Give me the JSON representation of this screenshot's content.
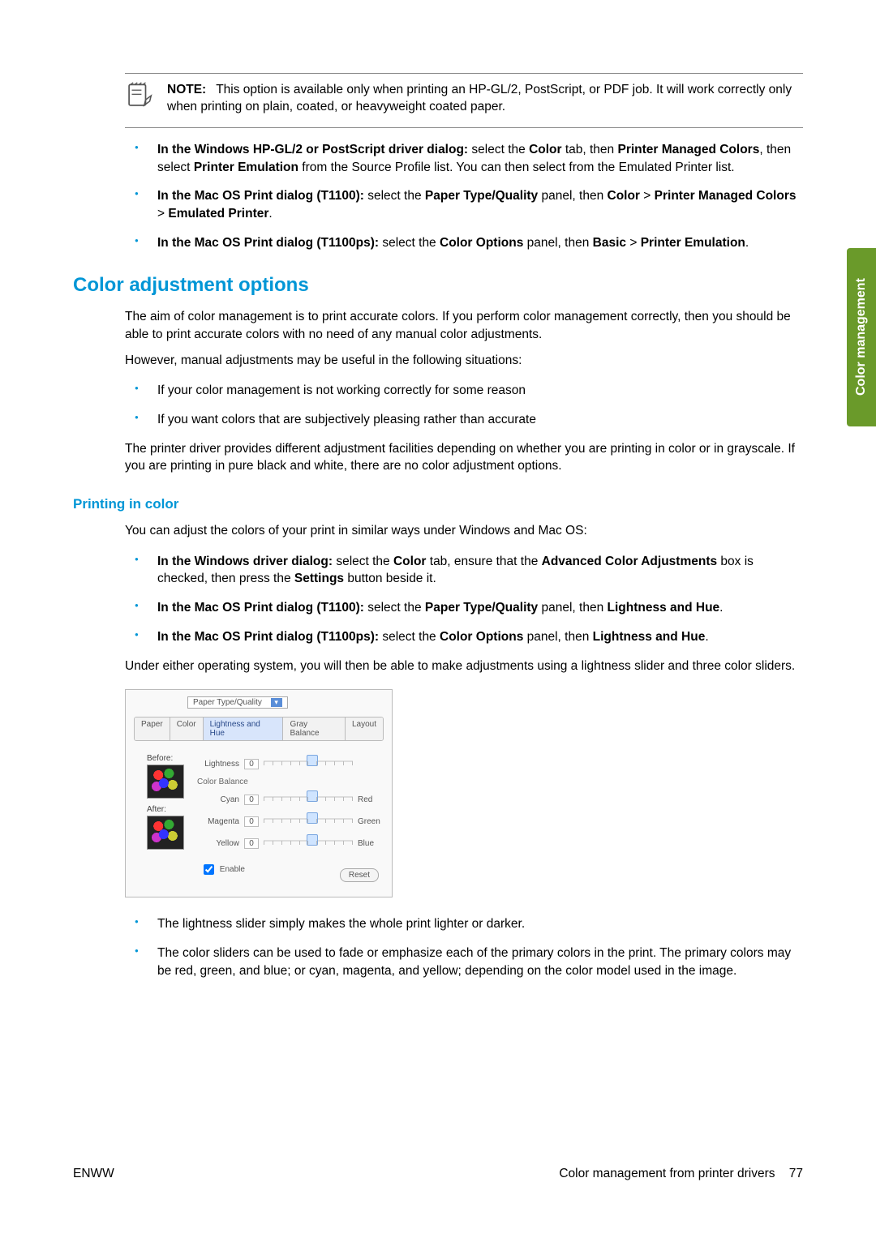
{
  "sideTab": "Color management",
  "note": {
    "label": "NOTE:",
    "text": "This option is available only when printing an HP-GL/2, PostScript, or PDF job. It will work correctly only when printing on plain, coated, or heavyweight coated paper."
  },
  "topList": [
    {
      "bold": "In the Windows HP-GL/2 or PostScript driver dialog:",
      "rest1": " select the ",
      "b2": "Color",
      "rest2": " tab, then ",
      "b3": "Printer Managed Colors",
      "rest3": ", then select ",
      "b4": "Printer Emulation",
      "rest4": " from the Source Profile list. You can then select from the Emulated Printer list."
    },
    {
      "bold": "In the Mac OS Print dialog (T1100):",
      "rest1": " select the ",
      "b2": "Paper Type/Quality",
      "rest2": " panel, then ",
      "b3": "Color",
      "rest3": " > ",
      "b4": "Printer Managed Colors",
      "rest4": " > ",
      "b5": "Emulated Printer",
      "rest5": "."
    },
    {
      "bold": "In the Mac OS Print dialog (T1100ps):",
      "rest1": " select the ",
      "b2": "Color Options",
      "rest2": " panel, then ",
      "b3": "Basic",
      "rest3": " > ",
      "b4": "Printer Emulation",
      "rest4": "."
    }
  ],
  "h2": "Color adjustment options",
  "p1": "The aim of color management is to print accurate colors. If you perform color management correctly, then you should be able to print accurate colors with no need of any manual color adjustments.",
  "p2": "However, manual adjustments may be useful in the following situations:",
  "list2": [
    "If your color management is not working correctly for some reason",
    "If you want colors that are subjectively pleasing rather than accurate"
  ],
  "p3": "The printer driver provides different adjustment facilities depending on whether you are printing in color or in grayscale. If you are printing in pure black and white, there are no color adjustment options.",
  "h3": "Printing in color",
  "p4": "You can adjust the colors of your print in similar ways under Windows and Mac OS:",
  "list3": [
    {
      "bold": "In the Windows driver dialog:",
      "rest1": " select the ",
      "b2": "Color",
      "rest2": " tab, ensure that the ",
      "b3": "Advanced Color Adjustments",
      "rest3": " box is checked, then press the ",
      "b4": "Settings",
      "rest4": " button beside it."
    },
    {
      "bold": "In the Mac OS Print dialog (T1100):",
      "rest1": " select the ",
      "b2": "Paper Type/Quality",
      "rest2": " panel, then ",
      "b3": "Lightness and Hue",
      "rest3": "."
    },
    {
      "bold": "In the Mac OS Print dialog (T1100ps):",
      "rest1": " select the ",
      "b2": "Color Options",
      "rest2": " panel, then ",
      "b3": "Lightness and Hue",
      "rest3": "."
    }
  ],
  "p5": "Under either operating system, you will then be able to make adjustments using a lightness slider and three color sliders.",
  "dialog": {
    "select": "Paper Type/Quality",
    "tabs": [
      "Paper",
      "Color",
      "Lightness and Hue",
      "Gray Balance",
      "Layout"
    ],
    "activeTabIndex": 2,
    "beforeLabel": "Before:",
    "afterLabel": "After:",
    "lightness": {
      "label": "Lightness",
      "value": "0"
    },
    "colorBalanceLabel": "Color Balance",
    "sliders": [
      {
        "label": "Cyan",
        "value": "0",
        "end": "Red"
      },
      {
        "label": "Magenta",
        "value": "0",
        "end": "Green"
      },
      {
        "label": "Yellow",
        "value": "0",
        "end": "Blue"
      }
    ],
    "enable": "Enable",
    "reset": "Reset"
  },
  "list4": [
    "The lightness slider simply makes the whole print lighter or darker.",
    "The color sliders can be used to fade or emphasize each of the primary colors in the print. The primary colors may be red, green, and blue; or cyan, magenta, and yellow; depending on the color model used in the image."
  ],
  "footer": {
    "left": "ENWW",
    "rightText": "Color management from printer drivers",
    "pageNum": "77"
  }
}
